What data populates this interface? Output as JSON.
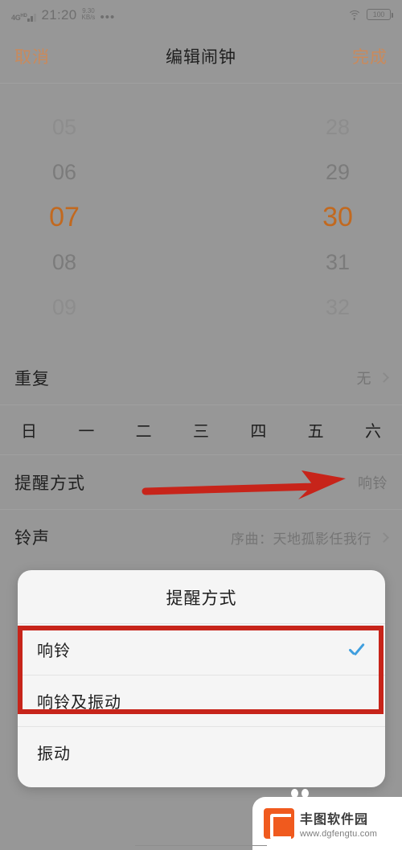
{
  "statusbar": {
    "network_type": "4G",
    "network_sup": "HD",
    "time": "21:20",
    "data_rate_value": "9.30",
    "data_rate_unit": "KB/s",
    "overflow_dots": "•••",
    "wifi_icon": "wifi-icon",
    "battery_level": "100"
  },
  "navbar": {
    "cancel_label": "取消",
    "title": "编辑闹钟",
    "done_label": "完成",
    "accent_color": "#c98a5c"
  },
  "time_picker": {
    "selected_hour": "07",
    "selected_minute": "30",
    "selected_color": "#c2691f",
    "hours": [
      "05",
      "06",
      "07",
      "08",
      "09"
    ],
    "minutes": [
      "28",
      "29",
      "30",
      "31",
      "32"
    ]
  },
  "rows": {
    "repeat": {
      "label": "重复",
      "value": "无"
    },
    "weekdays": [
      "日",
      "一",
      "二",
      "三",
      "四",
      "五",
      "六"
    ],
    "alert": {
      "label": "提醒方式",
      "value": "响铃"
    },
    "ringtone": {
      "label": "铃声",
      "value": "序曲：天地孤影任我行"
    }
  },
  "dialog": {
    "title": "提醒方式",
    "options": [
      {
        "label": "响铃",
        "checked": true
      },
      {
        "label": "响铃及振动",
        "checked": false
      },
      {
        "label": "振动",
        "checked": false
      }
    ],
    "check_color": "#3f9ede"
  },
  "annotations": {
    "arrow_color": "#c7241a",
    "box_color": "#c7241a"
  },
  "watermark": {
    "name": "丰图软件园",
    "url": "www.dgfengtu.com",
    "logo_color": "#f05a1e"
  }
}
